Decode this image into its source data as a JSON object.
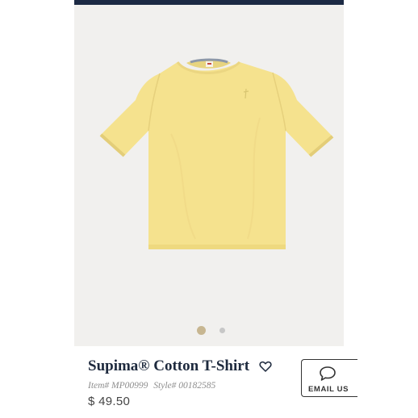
{
  "product": {
    "name": "Supima® Cotton T-Shirt",
    "item_number": "Item# MP00999",
    "style_number": "Style# 00182585",
    "price": "$ 49.50",
    "image_icon": "yellow-t-shirt-image",
    "colors": {
      "shirt": "#f5e28e",
      "shirt_shadow": "#e8d27a",
      "background": "#f1f0ee",
      "top_bar": "#1c2a44"
    }
  },
  "carousel": {
    "active_index": 0,
    "count": 2,
    "dot_colors": [
      "#c7b691",
      "#c7c7c7"
    ]
  },
  "actions": {
    "favorite_icon": "heart-icon",
    "email_label": "EMAIL US",
    "email_icon": "chat-bubble-icon"
  }
}
